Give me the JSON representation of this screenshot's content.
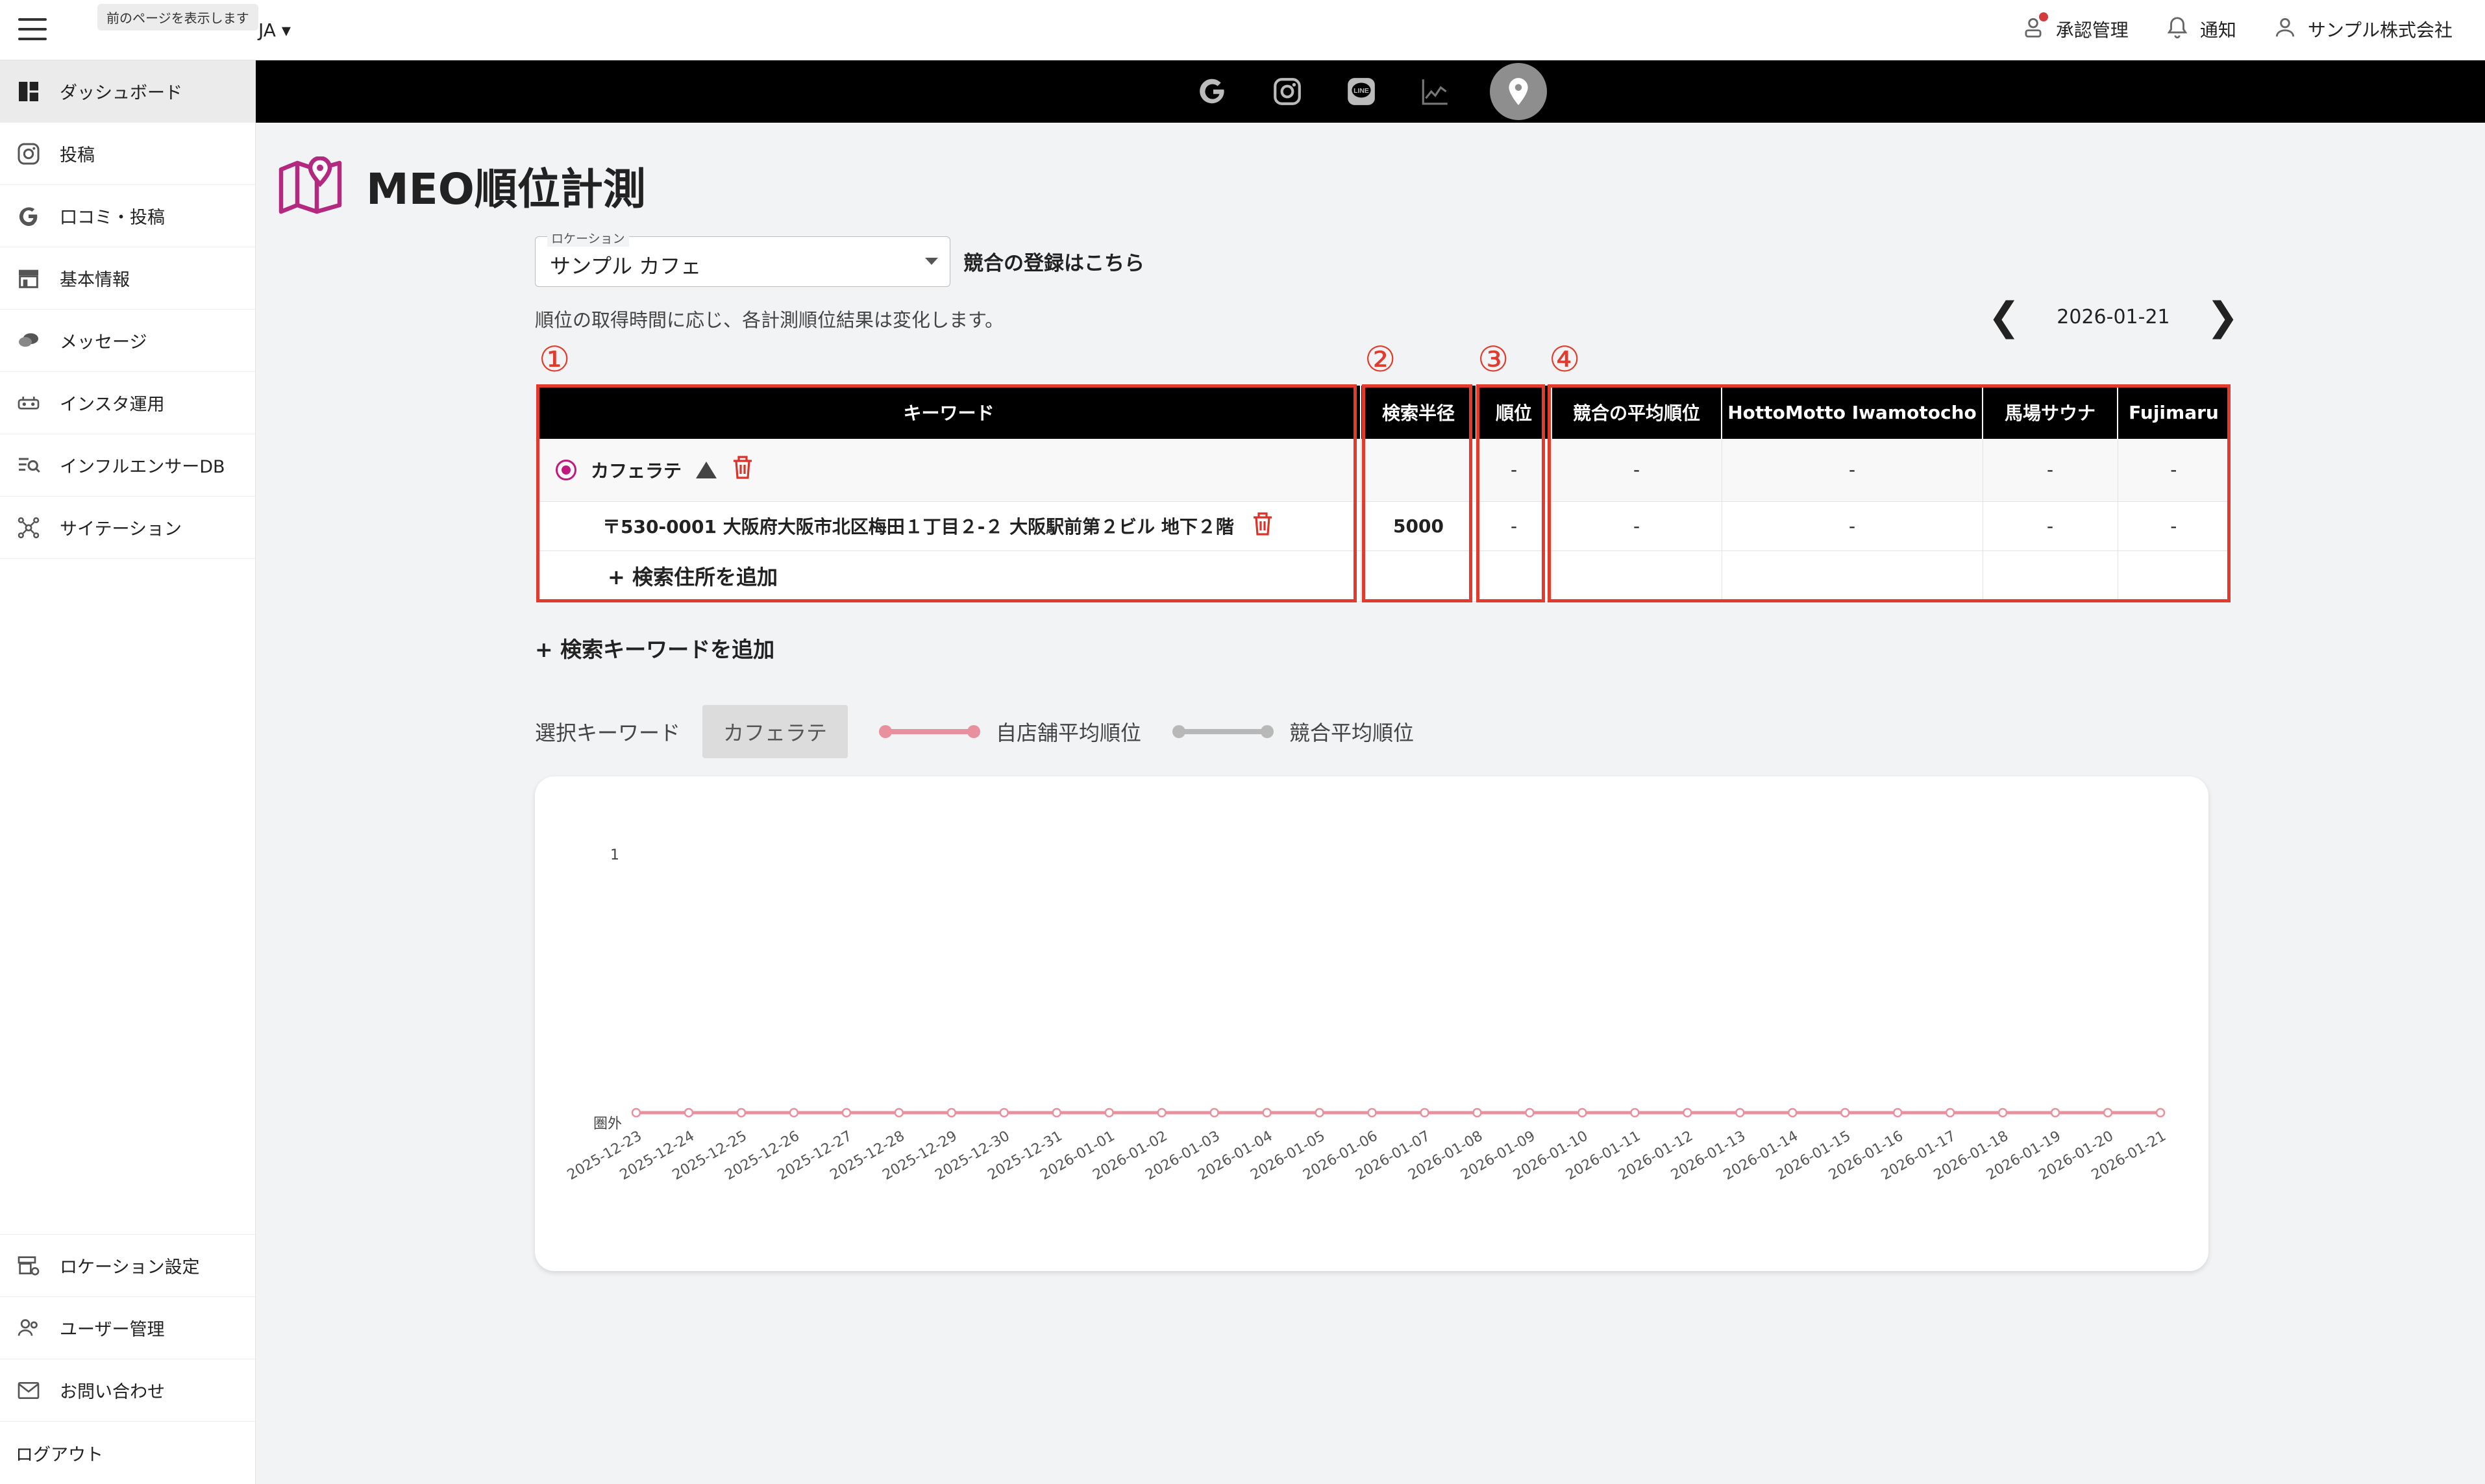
{
  "topbar": {
    "tooltip": "前のページを表示します",
    "lang": "JA ▾",
    "approval": "承認管理",
    "notifications": "通知",
    "company": "サンプル株式会社"
  },
  "sidebar": {
    "items": [
      {
        "label": "ダッシュボード",
        "icon": "dashboard-icon"
      },
      {
        "label": "投稿",
        "icon": "instagram-icon"
      },
      {
        "label": "口コミ・投稿",
        "icon": "google-icon"
      },
      {
        "label": "基本情報",
        "icon": "store-icon"
      },
      {
        "label": "メッセージ",
        "icon": "message-icon"
      },
      {
        "label": "インスタ運用",
        "icon": "instagram-ops-icon"
      },
      {
        "label": "インフルエンサーDB",
        "icon": "influencer-search-icon"
      },
      {
        "label": "サイテーション",
        "icon": "citation-network-icon"
      }
    ],
    "bottom": [
      {
        "label": "ロケーション設定",
        "icon": "location-settings-icon"
      },
      {
        "label": "ユーザー管理",
        "icon": "users-icon"
      },
      {
        "label": "お問い合わせ",
        "icon": "mail-icon"
      },
      {
        "label": "ログアウト"
      }
    ]
  },
  "platforms": [
    "google-icon",
    "instagram-icon",
    "line-icon",
    "chart-icon",
    "map-pin-icon"
  ],
  "page": {
    "title": "MEO順位計測",
    "location_label": "ロケーション",
    "location_value": "サンプル カフェ",
    "competitor_link": "競合の登録はこちら",
    "note": "順位の取得時間に応じ、各計測順位結果は変化します。",
    "date": "2026-01-21",
    "prev": "❮",
    "next": "❯",
    "markers": [
      "①",
      "②",
      "③",
      "④"
    ]
  },
  "table": {
    "headers": [
      "キーワード",
      "検索半径",
      "順位",
      "競合の平均順位",
      "HottoMotto Iwamotocho",
      "馬場サウナ",
      "Fujimaru"
    ],
    "keyword": {
      "name": "カフェラテ",
      "radius": "",
      "rank": "-",
      "avg": "-",
      "c1": "-",
      "c2": "-",
      "c3": "-"
    },
    "address": {
      "text": "〒530-0001 大阪府大阪市北区梅田１丁目２-２ 大阪駅前第２ビル 地下２階",
      "radius": "5000",
      "rank": "-",
      "avg": "-",
      "c1": "-",
      "c2": "-",
      "c3": "-"
    },
    "add_address": "+ 検索住所を追加"
  },
  "add_keyword": "+ 検索キーワードを追加",
  "selection": {
    "label": "選択キーワード",
    "chip": "カフェラテ",
    "legend_own": "自店舗平均順位",
    "legend_comp": "競合平均順位",
    "own_color": "#e8909e",
    "comp_color": "#b8b8b8"
  },
  "chart_data": {
    "type": "line",
    "y_ticks": [
      "1",
      "圏外"
    ],
    "x": [
      "2025-12-23",
      "2025-12-24",
      "2025-12-25",
      "2025-12-26",
      "2025-12-27",
      "2025-12-28",
      "2025-12-29",
      "2025-12-30",
      "2025-12-31",
      "2026-01-01",
      "2026-01-02",
      "2026-01-03",
      "2026-01-04",
      "2026-01-05",
      "2026-01-06",
      "2026-01-07",
      "2026-01-08",
      "2026-01-09",
      "2026-01-10",
      "2026-01-11",
      "2026-01-12",
      "2026-01-13",
      "2026-01-14",
      "2026-01-15",
      "2026-01-16",
      "2026-01-17",
      "2026-01-18",
      "2026-01-19",
      "2026-01-20",
      "2026-01-21"
    ],
    "series": [
      {
        "name": "自店舗平均順位",
        "values": [
          "圏外",
          "圏外",
          "圏外",
          "圏外",
          "圏外",
          "圏外",
          "圏外",
          "圏外",
          "圏外",
          "圏外",
          "圏外",
          "圏外",
          "圏外",
          "圏外",
          "圏外",
          "圏外",
          "圏外",
          "圏外",
          "圏外",
          "圏外",
          "圏外",
          "圏外",
          "圏外",
          "圏外",
          "圏外",
          "圏外",
          "圏外",
          "圏外",
          "圏外",
          "圏外"
        ]
      }
    ]
  }
}
